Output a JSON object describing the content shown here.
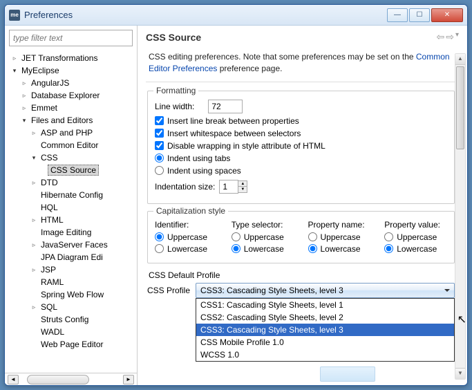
{
  "window": {
    "title": "Preferences",
    "icon_text": "me"
  },
  "filter_placeholder": "type filter text",
  "tree": [
    {
      "label": "JET Transformations",
      "indent": 0,
      "arrow": "right"
    },
    {
      "label": "MyEclipse",
      "indent": 0,
      "arrow": "down"
    },
    {
      "label": "AngularJS",
      "indent": 1,
      "arrow": "right"
    },
    {
      "label": "Database Explorer",
      "indent": 1,
      "arrow": "right"
    },
    {
      "label": "Emmet",
      "indent": 1,
      "arrow": "right"
    },
    {
      "label": "Files and Editors",
      "indent": 1,
      "arrow": "down"
    },
    {
      "label": "ASP and PHP",
      "indent": 2,
      "arrow": "right"
    },
    {
      "label": "Common Editor",
      "indent": 2,
      "arrow": "none"
    },
    {
      "label": "CSS",
      "indent": 2,
      "arrow": "down"
    },
    {
      "label": "CSS Source",
      "indent": 3,
      "arrow": "none",
      "selected": true
    },
    {
      "label": "DTD",
      "indent": 2,
      "arrow": "right"
    },
    {
      "label": "Hibernate Config",
      "indent": 2,
      "arrow": "none"
    },
    {
      "label": "HQL",
      "indent": 2,
      "arrow": "none"
    },
    {
      "label": "HTML",
      "indent": 2,
      "arrow": "right"
    },
    {
      "label": "Image Editing",
      "indent": 2,
      "arrow": "none"
    },
    {
      "label": "JavaServer Faces",
      "indent": 2,
      "arrow": "right"
    },
    {
      "label": "JPA Diagram Edi",
      "indent": 2,
      "arrow": "none"
    },
    {
      "label": "JSP",
      "indent": 2,
      "arrow": "right"
    },
    {
      "label": "RAML",
      "indent": 2,
      "arrow": "none"
    },
    {
      "label": "Spring Web Flow",
      "indent": 2,
      "arrow": "none"
    },
    {
      "label": "SQL",
      "indent": 2,
      "arrow": "right"
    },
    {
      "label": "Struts Config",
      "indent": 2,
      "arrow": "none"
    },
    {
      "label": "WADL",
      "indent": 2,
      "arrow": "none"
    },
    {
      "label": "Web Page Editor",
      "indent": 2,
      "arrow": "none"
    }
  ],
  "page": {
    "title": "CSS Source",
    "desc_prefix": "CSS editing preferences.  Note that some preferences may be set on the ",
    "desc_link": "Common Editor Preferences",
    "desc_suffix": " preference page."
  },
  "formatting": {
    "title": "Formatting",
    "line_width_label": "Line width:",
    "line_width_value": "72",
    "insert_break": "Insert line break between properties",
    "insert_ws": "Insert whitespace between selectors",
    "disable_wrap": "Disable wrapping in style attribute of HTML",
    "indent_tabs": "Indent using tabs",
    "indent_spaces": "Indent using spaces",
    "indent_size_label": "Indentation size:",
    "indent_size_value": "1"
  },
  "cap": {
    "title": "Capitalization style",
    "cols": [
      {
        "hdr": "Identifier:",
        "upper": "Uppercase",
        "lower": "Lowercase",
        "sel": "upper"
      },
      {
        "hdr": "Type selector:",
        "upper": "Uppercase",
        "lower": "Lowercase",
        "sel": "lower"
      },
      {
        "hdr": "Property name:",
        "upper": "Uppercase",
        "lower": "Lowercase",
        "sel": "lower"
      },
      {
        "hdr": "Property value:",
        "upper": "Uppercase",
        "lower": "Lowercase",
        "sel": "lower"
      }
    ]
  },
  "profile": {
    "group_title": "CSS Default Profile",
    "label": "CSS Profile",
    "value": "CSS3: Cascading Style Sheets, level 3",
    "options": [
      "CSS1: Cascading Style Sheets, level 1",
      "CSS2: Cascading Style Sheets, level 2",
      "CSS3: Cascading Style Sheets, level 3",
      "CSS Mobile Profile 1.0",
      "WCSS 1.0"
    ],
    "highlight_index": 2
  }
}
